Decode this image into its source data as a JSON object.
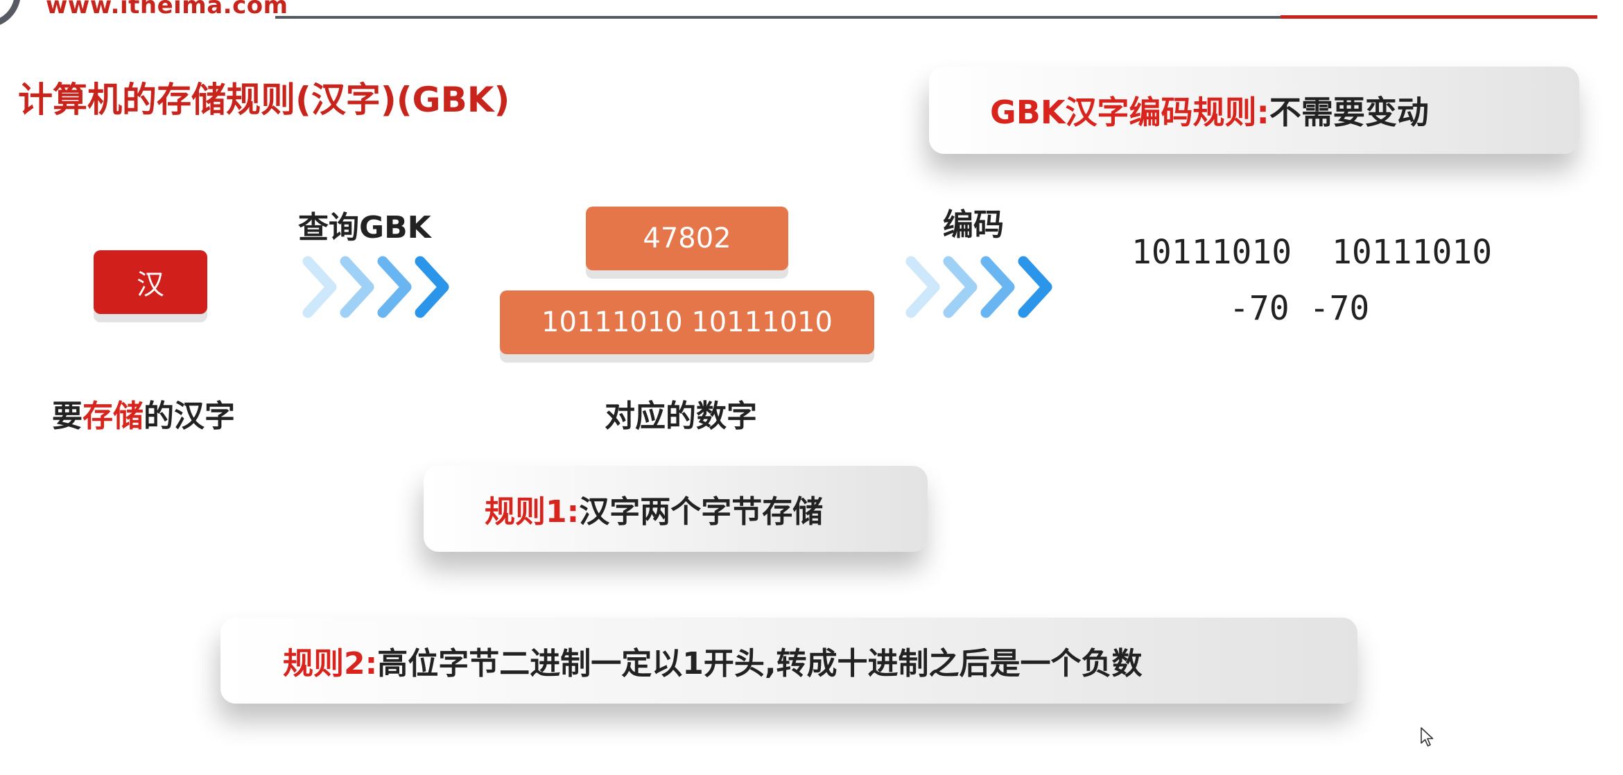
{
  "header": {
    "url": "www.itheima.com",
    "accent_color": "#c8241c",
    "line_color": "#54585f"
  },
  "title": "计算机的存储规则(汉字)(GBK)",
  "callouts": {
    "gbk": {
      "highlight": "GBK汉字编码规则:",
      "text": "不需要变动"
    },
    "rule1": {
      "highlight": "规则1:",
      "text": "汉字两个字节存储"
    },
    "rule2": {
      "highlight": "规则2:",
      "text": "高位字节二进制一定以1开头,转成十进制之后是一个负数"
    }
  },
  "flow": {
    "character": "汉",
    "query_label": "查询GBK",
    "decimal_value": "47802",
    "binary_value": "10111010 10111010",
    "encode_label": "编码",
    "encoded_binary": "10111010  10111010",
    "encoded_decimal": "-70 -70",
    "store_label": {
      "prefix": "要",
      "highlight": "存储",
      "suffix": "的汉字"
    },
    "number_label": "对应的数字",
    "char_box_color": "#d11f1b",
    "number_box_color": "#e5764a",
    "arrow_icon": "chevrons-right-icon"
  }
}
